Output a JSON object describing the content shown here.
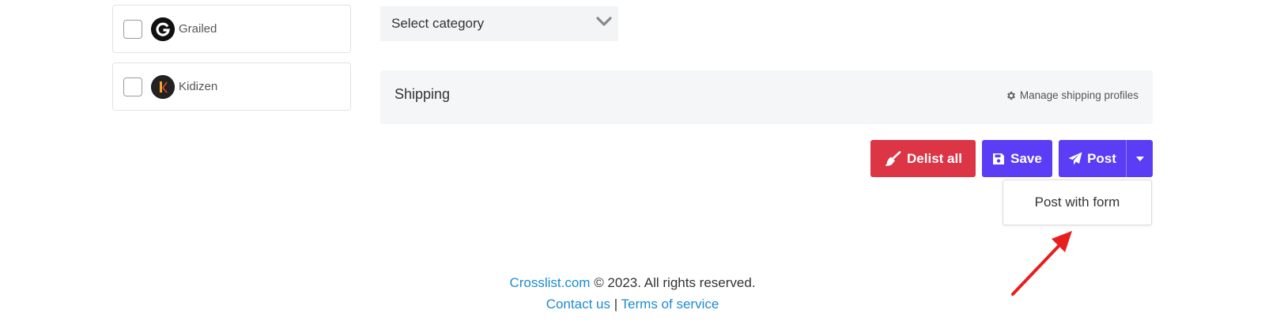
{
  "marketplaces": [
    {
      "label": "Grailed",
      "checked": false,
      "icon": "grailed-logo"
    },
    {
      "label": "Kidizen",
      "checked": false,
      "icon": "kidizen-logo"
    }
  ],
  "category": {
    "placeholder": "Select category",
    "icon": "chevron-down-icon"
  },
  "shipping": {
    "title": "Shipping",
    "manage_label": "Manage shipping profiles",
    "manage_icon": "gear-icon"
  },
  "actions": {
    "delist_label": "Delist all",
    "delist_icon": "broom-icon",
    "save_label": "Save",
    "save_icon": "floppy-disk-icon",
    "post_label": "Post",
    "post_icon": "paper-plane-icon",
    "post_menu": [
      "Post with form"
    ]
  },
  "footer": {
    "brand": "Crosslist.com",
    "copyright": "© 2023. All rights reserved.",
    "contact": "Contact us",
    "separator": "|",
    "terms": "Terms of service"
  },
  "colors": {
    "danger": "#dc3545",
    "primary": "#5b3df5",
    "link": "#1e8bd0",
    "annotation_arrow": "#e81e1e"
  }
}
